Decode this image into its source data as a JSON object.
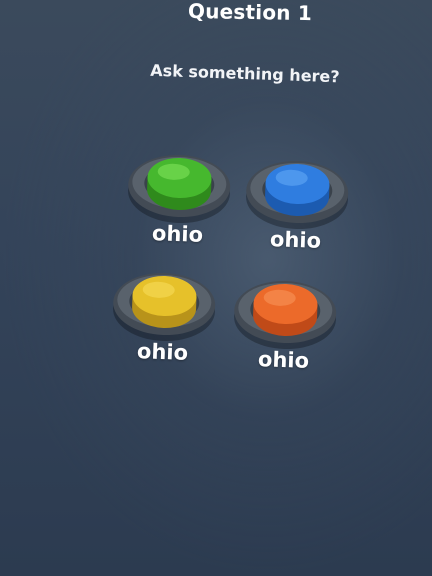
{
  "question": {
    "title": "Question 1",
    "prompt": "Ask something here?"
  },
  "answers": [
    {
      "label": "ohio",
      "color": "#46b82e",
      "highlight": "#7fe35a",
      "shade": "#2f8a1c"
    },
    {
      "label": "ohio",
      "color": "#2f7de0",
      "highlight": "#62a8f5",
      "shade": "#1c5bb0"
    },
    {
      "label": "ohio",
      "color": "#e6c12a",
      "highlight": "#f6dc5a",
      "shade": "#b8931a"
    },
    {
      "label": "ohio",
      "color": "#ec6a2a",
      "highlight": "#f8945a",
      "shade": "#c04a18"
    }
  ]
}
